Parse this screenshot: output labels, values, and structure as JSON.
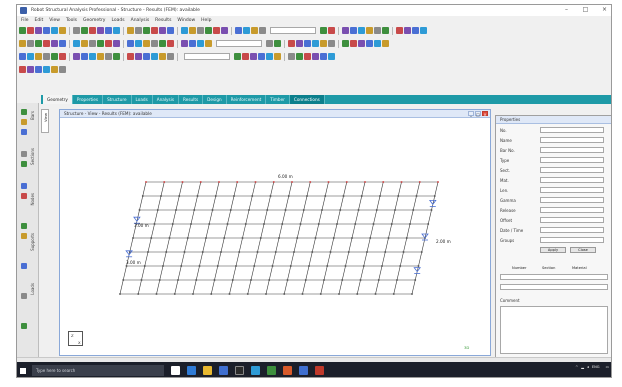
{
  "window": {
    "title": "Robot Structural Analysis Professional - Structure - Results (FEM): available",
    "controls": [
      "–",
      "□",
      "×"
    ]
  },
  "menu": [
    "File",
    "Edit",
    "View",
    "Tools",
    "Geometry",
    "Loads",
    "Analysis",
    "Results",
    "Window",
    "Help"
  ],
  "colors": {
    "tab_bar": "#1e9aa7",
    "grid_line": "#3a3a3a",
    "support": "#4a6fd4",
    "node_marker": "#d04040",
    "taskbar": "#1b1f2a"
  },
  "tabs": [
    {
      "label": "Geometry",
      "state": "active"
    },
    {
      "label": "Properties",
      "state": "normal"
    },
    {
      "label": "Structure",
      "state": "normal"
    },
    {
      "label": "Loads",
      "state": "normal"
    },
    {
      "label": "Analysis",
      "state": "normal"
    },
    {
      "label": "Results",
      "state": "normal"
    },
    {
      "label": "Design",
      "state": "normal"
    },
    {
      "label": "Reinforcement",
      "state": "normal"
    },
    {
      "label": "Timber",
      "state": "normal"
    },
    {
      "label": "Connections",
      "state": "hl"
    }
  ],
  "left_rail_labels": [
    "Bars",
    "Sections",
    "Nodes",
    "Supports",
    "Loads"
  ],
  "side_tab_label": "View",
  "model_window": {
    "title": "Structure - View - Results (FEM): available",
    "buttons": [
      "_",
      "□",
      "×"
    ],
    "annotations": {
      "top_dim": "6.00 m",
      "left_dim_1": "3.00 m",
      "left_dim_2": "3.00 m",
      "right_dim": "2.00 m"
    },
    "axis_labels": {
      "z": "Z",
      "x": "X"
    },
    "status_chip": "3D"
  },
  "properties_panel": {
    "title": "Properties",
    "rows": [
      {
        "label": "No.",
        "value": ""
      },
      {
        "label": "Name",
        "value": ""
      },
      {
        "label": "Bar No.",
        "value": ""
      },
      {
        "label": "Type",
        "value": ""
      },
      {
        "label": "Sect.",
        "value": ""
      },
      {
        "label": "Mat.",
        "value": ""
      },
      {
        "label": "Len.",
        "value": ""
      },
      {
        "label": "Gamma",
        "value": ""
      },
      {
        "label": "Release",
        "value": ""
      },
      {
        "label": "Offset",
        "value": ""
      },
      {
        "label": "Date / Time",
        "value": ""
      },
      {
        "label": "Groups",
        "value": ""
      }
    ],
    "buttons": [
      "Apply",
      "Close"
    ],
    "columns": [
      "Number",
      "Section",
      "Material"
    ],
    "bottom_label": "Comment"
  },
  "status_bar": {
    "left": "",
    "mid": "",
    "right": ""
  },
  "taskbar": {
    "search_placeholder": "Type here to search",
    "tray": {
      "lang": "ENG",
      "time": "",
      "date": ""
    }
  }
}
